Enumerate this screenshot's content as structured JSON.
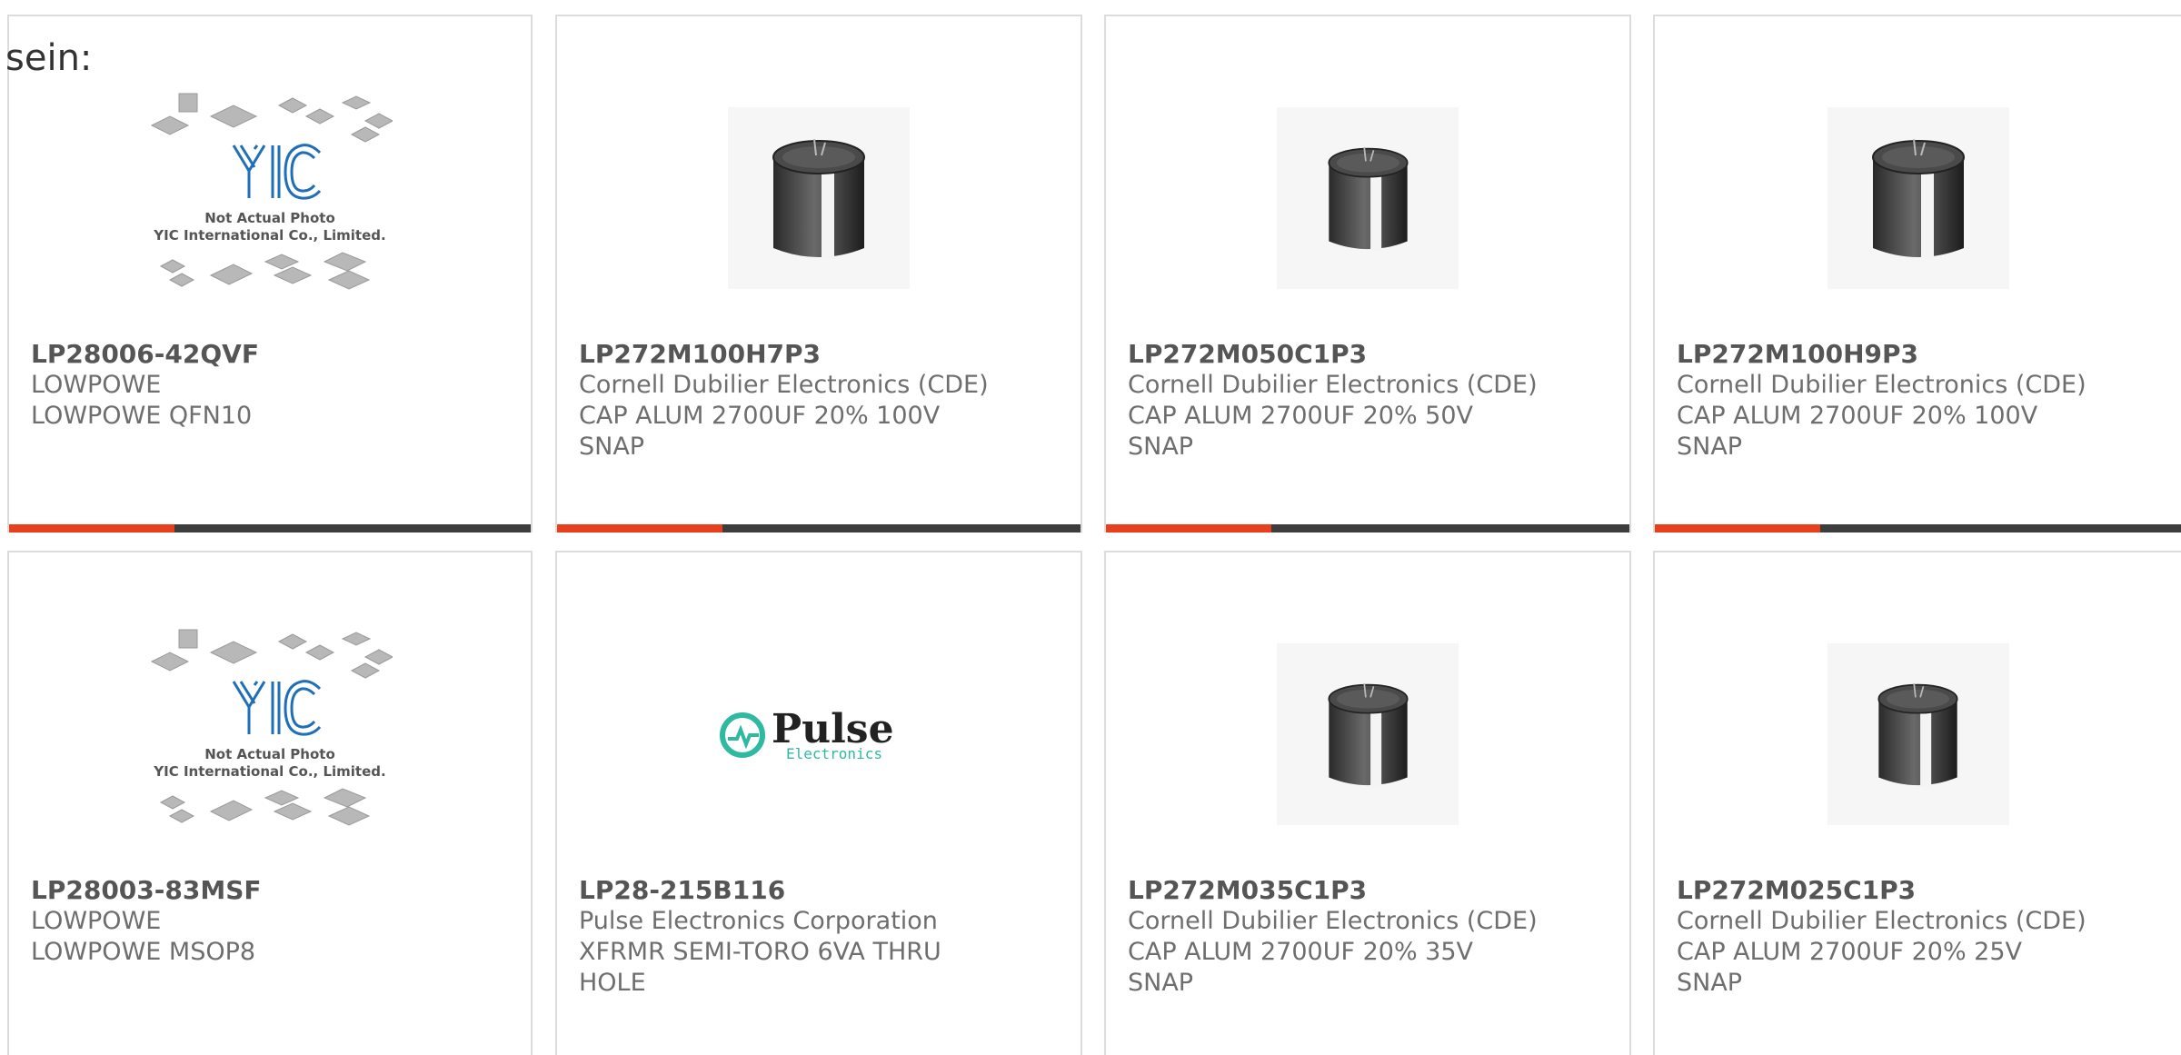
{
  "intro": {
    "text": "sein:"
  },
  "products": [
    {
      "part_number": "LP28006-42QVF",
      "manufacturer": "LOWPOWE",
      "description_line1": "LOWPOWE QFN10",
      "description_line2": "",
      "image": "placeholder-chips-photo",
      "image_caption1": "Not Actual Photo",
      "image_caption2": "YIC International Co., Limited."
    },
    {
      "part_number": "LP272M100H7P3",
      "manufacturer": "Cornell Dubilier Electronics (CDE)",
      "description_line1": "CAP ALUM 2700UF 20% 100V",
      "description_line2": "SNAP",
      "image": "capacitor-photo"
    },
    {
      "part_number": "LP272M050C1P3",
      "manufacturer": "Cornell Dubilier Electronics (CDE)",
      "description_line1": "CAP ALUM 2700UF 20% 50V",
      "description_line2": "SNAP",
      "image": "capacitor-photo"
    },
    {
      "part_number": "LP272M100H9P3",
      "manufacturer": "Cornell Dubilier Electronics (CDE)",
      "description_line1": "CAP ALUM 2700UF 20% 100V",
      "description_line2": "SNAP",
      "image": "capacitor-photo"
    },
    {
      "part_number": "LP28003-83MSF",
      "manufacturer": "LOWPOWE",
      "description_line1": "LOWPOWE MSOP8",
      "description_line2": "",
      "image": "placeholder-chips-photo",
      "image_caption1": "Not Actual Photo",
      "image_caption2": "YIC International Co., Limited."
    },
    {
      "part_number": "LP28-215B116",
      "manufacturer": "Pulse Electronics Corporation",
      "description_line1": "XFRMR SEMI-TORO 6VA THRU",
      "description_line2": "HOLE",
      "image": "pulse-logo",
      "logo_word": "Pulse",
      "logo_sub": "Electronics"
    },
    {
      "part_number": "LP272M035C1P3",
      "manufacturer": "Cornell Dubilier Electronics (CDE)",
      "description_line1": "CAP ALUM 2700UF 20% 35V",
      "description_line2": "SNAP",
      "image": "capacitor-photo"
    },
    {
      "part_number": "LP272M025C1P3",
      "manufacturer": "Cornell Dubilier Electronics (CDE)",
      "description_line1": "CAP ALUM 2700UF 20% 25V",
      "description_line2": "SNAP",
      "image": "capacitor-photo"
    }
  ],
  "colors": {
    "accent": "#e8401c",
    "bar": "#3d3d3d",
    "border": "#dcdcdc",
    "yic_logo": "#1e6fb8",
    "pulse_teal": "#2fb9a0"
  }
}
